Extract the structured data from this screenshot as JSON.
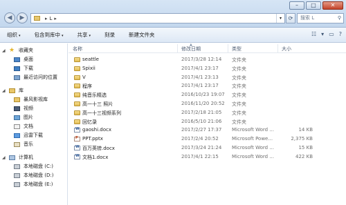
{
  "window": {
    "minimize": "–",
    "maximize": "□",
    "close": "✕"
  },
  "nav": {
    "back": "◀",
    "forward": "▶"
  },
  "address": {
    "sep1": "▸",
    "segment": "L",
    "sep2": "▸",
    "dropdown": "▾"
  },
  "search": {
    "placeholder": "搜索 L",
    "icon": "search-icon"
  },
  "toolbar": {
    "organize": "组织",
    "include_in_library": "包含到库中",
    "share": "共享",
    "burn": "刻录",
    "new_folder": "新建文件夹",
    "arrow": "▾"
  },
  "toolbar_right": {
    "view": "☷",
    "view_arrow": "▾",
    "preview": "▭",
    "help": "?"
  },
  "sidebar": {
    "favorites": "收藏夹",
    "desktop": "桌面",
    "downloads": "下载",
    "recent": "最近访问的位置",
    "libraries": "库",
    "storm_video": "暴风影视库",
    "videos": "视频",
    "pictures": "图片",
    "documents": "文档",
    "thunder_downloads": "迅雷下载",
    "music": "音乐",
    "computer": "计算机",
    "disk_c": "本地磁盘 (C:)",
    "disk_d": "本地磁盘 (D:)",
    "disk_e": "本地磁盘 (E:)"
  },
  "columns": {
    "name": "名称",
    "modified": "修改日期",
    "type": "类型",
    "size": "大小",
    "sort_indicator": "▲"
  },
  "files": [
    {
      "name": "seattle",
      "date": "2017/3/28 12:14",
      "type": "文件夹",
      "size": "",
      "kind": "folder"
    },
    {
      "name": "Spixii",
      "date": "2017/4/1 23:17",
      "type": "文件夹",
      "size": "",
      "kind": "folder"
    },
    {
      "name": "V",
      "date": "2017/4/1 23:13",
      "type": "文件夹",
      "size": "",
      "kind": "folder"
    },
    {
      "name": "程序",
      "date": "2017/4/1 23:17",
      "type": "文件夹",
      "size": "",
      "kind": "folder"
    },
    {
      "name": "纯音乐精选",
      "date": "2016/10/23 19:07",
      "type": "文件夹",
      "size": "",
      "kind": "folder"
    },
    {
      "name": "高一十三 照片",
      "date": "2016/11/20 20:52",
      "type": "文件夹",
      "size": "",
      "kind": "folder"
    },
    {
      "name": "高一十三视频系列",
      "date": "2017/2/18 21:05",
      "type": "文件夹",
      "size": "",
      "kind": "folder"
    },
    {
      "name": "回忆录",
      "date": "2016/5/10 21:06",
      "type": "文件夹",
      "size": "",
      "kind": "folder"
    },
    {
      "name": "gaoshi.docx",
      "date": "2017/2/27 17:37",
      "type": "Microsoft Word ...",
      "size": "14 KB",
      "kind": "word"
    },
    {
      "name": "PPT.pptx",
      "date": "2017/2/4 20:52",
      "type": "Microsoft Powe...",
      "size": "2,375 KB",
      "kind": "ppt"
    },
    {
      "name": "百万英镑.docx",
      "date": "2017/3/24 21:24",
      "type": "Microsoft Word ...",
      "size": "15 KB",
      "kind": "word"
    },
    {
      "name": "文档1.docx",
      "date": "2017/4/1 22:15",
      "type": "Microsoft Word ...",
      "size": "422 KB",
      "kind": "word"
    }
  ]
}
